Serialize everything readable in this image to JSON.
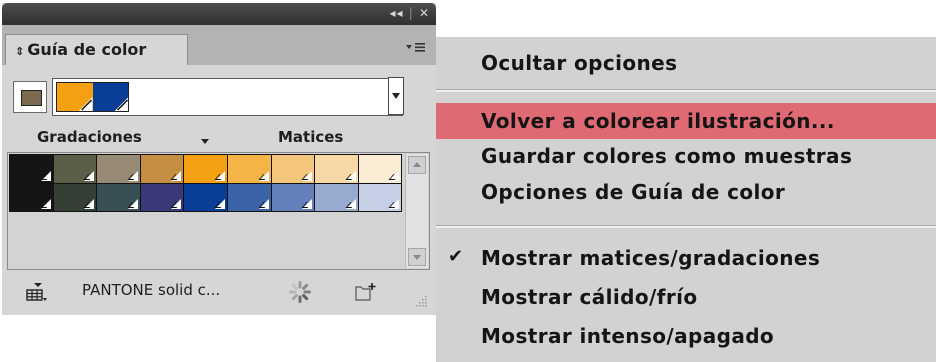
{
  "panel": {
    "tab_title": "Guía de color",
    "tab_prefix_icon": "collapse-arrows-icon",
    "harmony_colors": [
      "#f4a010",
      "#0a3d96"
    ],
    "base_color": "#7a6a50",
    "labels": {
      "gradations": "Gradaciones",
      "tints": "Matices"
    },
    "variations_rows": [
      [
        "#151515",
        "#5a5f49",
        "#978b76",
        "#c48e43",
        "#f4a010",
        "#f4b448",
        "#f4c67c",
        "#f7d9a8",
        "#fbecd4"
      ],
      [
        "#151515",
        "#353f35",
        "#374f55",
        "#3a3a78",
        "#0a3d96",
        "#3a63a8",
        "#6480ba",
        "#97aacf",
        "#c6d0e6"
      ]
    ],
    "library_label": "PANTONE solid c...",
    "icons": {
      "library": "library-grid-icon",
      "edit_colors": "color-wheel-icon",
      "save_group": "new-color-group-icon",
      "menu": "panel-menu-icon",
      "close": "close-icon",
      "collapse": "collapse-panel-icon"
    }
  },
  "menu": {
    "items": [
      {
        "label": "Ocultar opciones",
        "checked": false,
        "highlighted": false
      },
      {
        "label": "Volver a colorear ilustración...",
        "checked": false,
        "highlighted": true
      },
      {
        "label": "Guardar colores como muestras",
        "checked": false,
        "highlighted": false
      },
      {
        "label": "Opciones de Guía de color",
        "checked": false,
        "highlighted": false
      },
      {
        "label": "Mostrar matices/gradaciones",
        "checked": true,
        "highlighted": false
      },
      {
        "label": "Mostrar cálido/frío",
        "checked": false,
        "highlighted": false
      },
      {
        "label": "Mostrar intenso/apagado",
        "checked": false,
        "highlighted": false
      }
    ],
    "highlight_color": "#e06a74",
    "check_glyph": "✔"
  }
}
